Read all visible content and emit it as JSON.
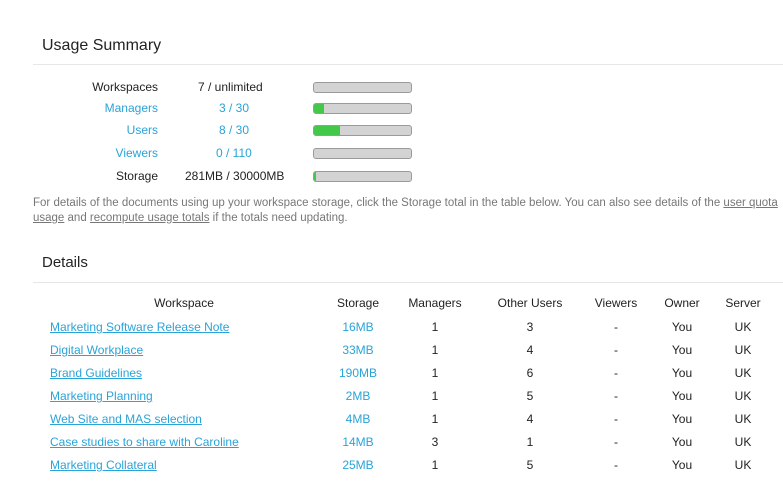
{
  "usage_summary": {
    "title": "Usage Summary",
    "rows": [
      {
        "label": "Workspaces",
        "value": "7 / unlimited",
        "fill": 0,
        "link": false
      },
      {
        "label": "Managers",
        "value": "3 / 30",
        "fill": 0.1,
        "link": true
      },
      {
        "label": "Users",
        "value": "8 / 30",
        "fill": 0.27,
        "link": true
      },
      {
        "label": "Viewers",
        "value": "0 / 110",
        "fill": 0,
        "link": true
      },
      {
        "label": "Storage",
        "value": "281MB / 30000MB",
        "fill": 0.01,
        "link": false
      }
    ],
    "note": {
      "text_1": "For details of the documents using up your workspace storage, click the Storage total in the table below. You can also see details of the ",
      "link_1": "user quota usage",
      "text_2": " and ",
      "link_2": "recompute usage totals",
      "text_3": " if the totals need updating."
    }
  },
  "details": {
    "title": "Details",
    "columns": {
      "workspace": "Workspace",
      "storage": "Storage",
      "managers": "Managers",
      "other_users": "Other Users",
      "viewers": "Viewers",
      "owner": "Owner",
      "server": "Server"
    },
    "rows": [
      {
        "workspace": "Marketing Software Release Note",
        "storage": "16MB",
        "managers": "1",
        "other_users": "3",
        "viewers": "-",
        "owner": "You",
        "server": "UK"
      },
      {
        "workspace": "Digital Workplace",
        "storage": "33MB",
        "managers": "1",
        "other_users": "4",
        "viewers": "-",
        "owner": "You",
        "server": "UK"
      },
      {
        "workspace": "Brand Guidelines",
        "storage": "190MB",
        "managers": "1",
        "other_users": "6",
        "viewers": "-",
        "owner": "You",
        "server": "UK"
      },
      {
        "workspace": "Marketing Planning",
        "storage": "2MB",
        "managers": "1",
        "other_users": "5",
        "viewers": "-",
        "owner": "You",
        "server": "UK"
      },
      {
        "workspace": "Web Site and MAS selection",
        "storage": "4MB",
        "managers": "1",
        "other_users": "4",
        "viewers": "-",
        "owner": "You",
        "server": "UK"
      },
      {
        "workspace": "Case studies to share with Caroline",
        "storage": "14MB",
        "managers": "3",
        "other_users": "1",
        "viewers": "-",
        "owner": "You",
        "server": "UK"
      },
      {
        "workspace": "Marketing Collateral",
        "storage": "25MB",
        "managers": "1",
        "other_users": "5",
        "viewers": "-",
        "owner": "You",
        "server": "UK"
      }
    ]
  },
  "colors": {
    "link": "#2aa3d8",
    "bar_fill": "#44c84a",
    "bar_track": "#d3d3d3"
  }
}
